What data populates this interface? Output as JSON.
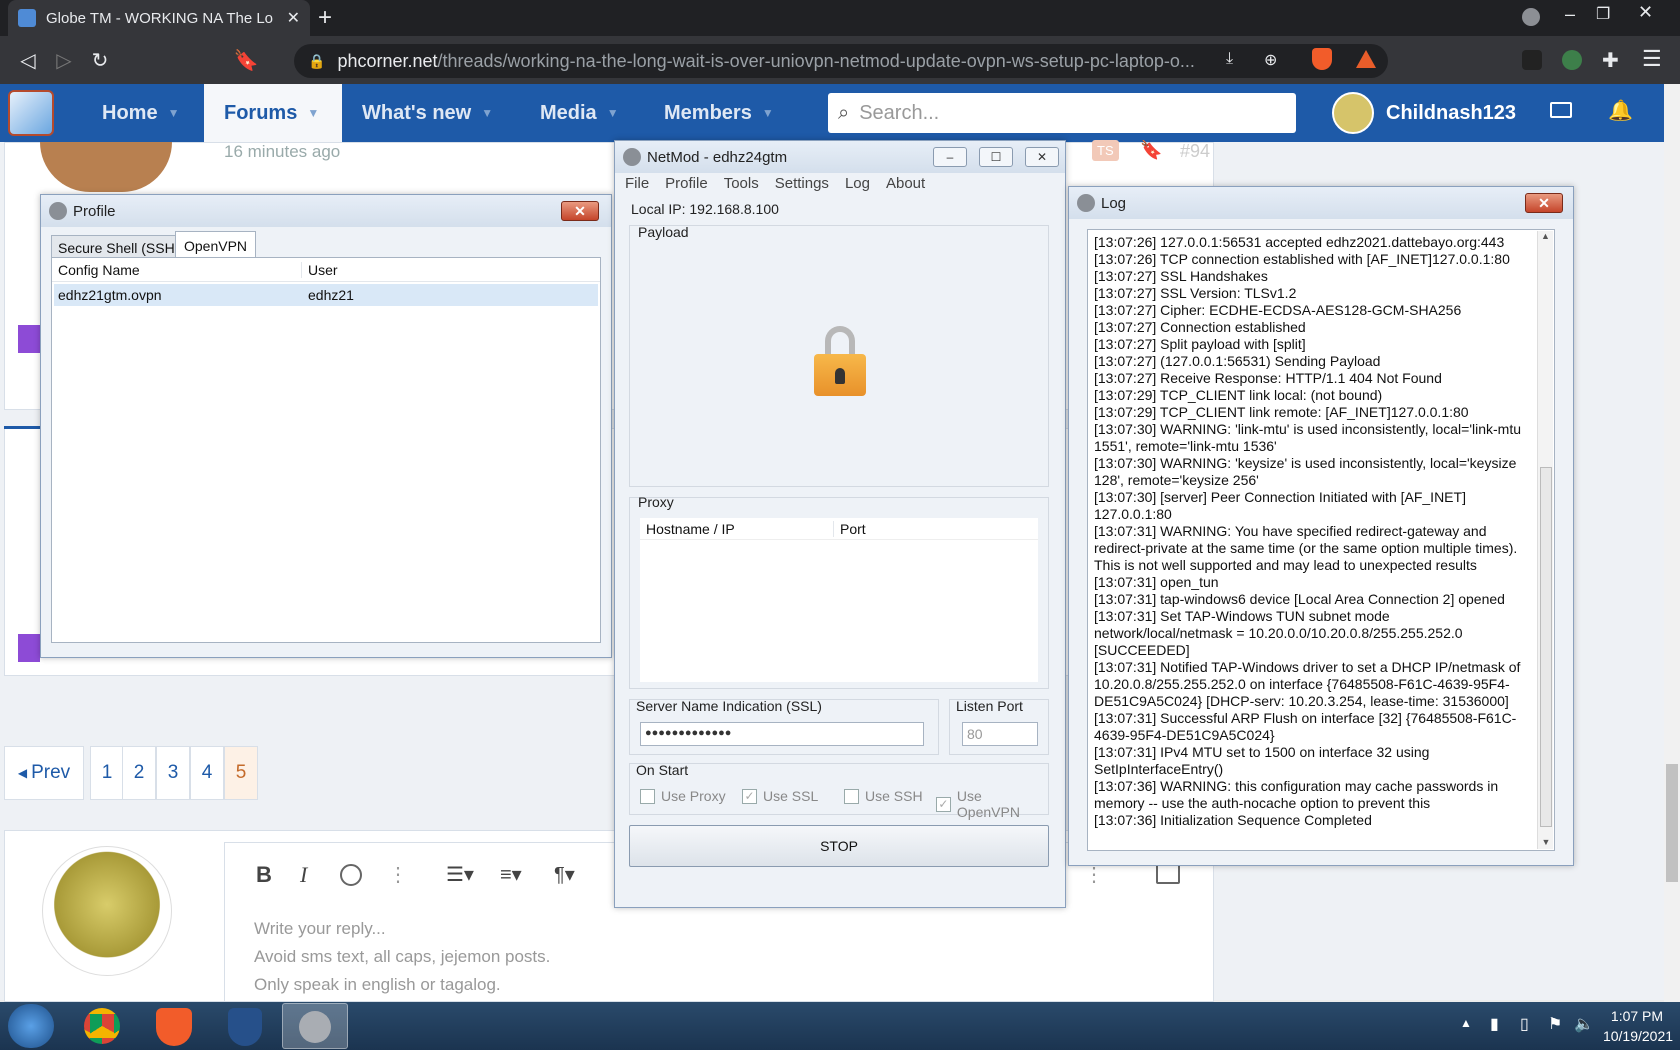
{
  "browser": {
    "tab_title": "Globe TM - WORKING NA The Lo",
    "url_host": "phcorner.net",
    "url_path": "/threads/working-na-the-long-wait-is-over-uniovpn-netmod-update-ovpn-ws-setup-pc-laptop-o..."
  },
  "site": {
    "nav": [
      "Home",
      "Forums",
      "What's new",
      "Media",
      "Members"
    ],
    "search_placeholder": "Search...",
    "username": "Childnash123"
  },
  "forum": {
    "post_time": "16 minutes ago",
    "post_badge": "TS",
    "post_number": "#94",
    "pagination": {
      "prev": "Prev",
      "pages": [
        "1",
        "2",
        "3",
        "4",
        "5"
      ],
      "current": "5"
    },
    "reply": {
      "placeholder_lines": [
        "Write your reply...",
        "Avoid sms text, all caps, jejemon posts.",
        "Only speak in english or tagalog."
      ]
    }
  },
  "profile_window": {
    "title": "Profile",
    "tabs": [
      "Secure Shell (SSH)",
      "OpenVPN"
    ],
    "active_tab": "OpenVPN",
    "columns": [
      "Config Name",
      "User"
    ],
    "rows": [
      {
        "config": "edhz21gtm.ovpn",
        "user": "edhz21"
      }
    ]
  },
  "netmod_window": {
    "title": "NetMod - edhz24gtm",
    "menu": [
      "File",
      "Profile",
      "Tools",
      "Settings",
      "Log",
      "About"
    ],
    "local_ip": "Local IP: 192.168.8.100",
    "payload_label": "Payload",
    "proxy_label": "Proxy",
    "proxy_columns": [
      "Hostname / IP",
      "Port"
    ],
    "sni_label": "Server Name Indication (SSL)",
    "sni_value": "●●●●●●●●●●●●●",
    "listen_port_label": "Listen Port",
    "listen_port_value": "80",
    "on_start_label": "On Start",
    "checkboxes": [
      {
        "label": "Use Proxy",
        "checked": false
      },
      {
        "label": "Use SSL",
        "checked": true
      },
      {
        "label": "Use SSH",
        "checked": false
      },
      {
        "label": "Use OpenVPN",
        "checked": true
      }
    ],
    "stop_label": "STOP"
  },
  "log_window": {
    "title": "Log",
    "lines": [
      "[13:07:26] 127.0.0.1:56531 accepted edhz2021.dattebayo.org:443",
      "[13:07:26] TCP connection established with [AF_INET]127.0.0.1:80",
      "[13:07:27] SSL Handshakes",
      "[13:07:27] SSL Version: TLSv1.2",
      "[13:07:27] Cipher: ECDHE-ECDSA-AES128-GCM-SHA256",
      "[13:07:27] Connection established",
      "[13:07:27] Split payload with [split]",
      "[13:07:27] (127.0.0.1:56531) Sending Payload",
      "[13:07:27] Receive Response: HTTP/1.1 404 Not Found",
      "[13:07:29] TCP_CLIENT link local: (not bound)",
      "[13:07:29] TCP_CLIENT link remote: [AF_INET]127.0.0.1:80",
      "[13:07:30] WARNING: 'link-mtu' is used inconsistently, local='link-mtu",
      "1551', remote='link-mtu 1536'",
      "[13:07:30] WARNING: 'keysize' is used inconsistently, local='keysize",
      "128', remote='keysize 256'",
      "[13:07:30] [server] Peer Connection Initiated with [AF_INET]",
      "127.0.0.1:80",
      "[13:07:31] WARNING: You have specified redirect-gateway and",
      "redirect-private at the same time (or the same option multiple times).",
      "This is not well supported and may lead to unexpected results",
      "[13:07:31] open_tun",
      "[13:07:31] tap-windows6 device [Local Area Connection 2] opened",
      "[13:07:31] Set TAP-Windows TUN subnet mode",
      "network/local/netmask = 10.20.0.0/10.20.0.8/255.255.252.0",
      "[SUCCEEDED]",
      "[13:07:31] Notified TAP-Windows driver to set a DHCP IP/netmask of",
      "10.20.0.8/255.255.252.0 on interface {76485508-F61C-4639-95F4-",
      "DE51C9A5C024} [DHCP-serv: 10.20.3.254, lease-time: 31536000]",
      "[13:07:31] Successful ARP Flush on interface [32] {76485508-F61C-",
      "4639-95F4-DE51C9A5C024}",
      "[13:07:31] IPv4 MTU set to 1500 on interface 32 using",
      "SetIpInterfaceEntry()",
      "[13:07:36] WARNING: this configuration may cache passwords in",
      "memory -- use the auth-nocache option to prevent this",
      "[13:07:36] Initialization Sequence Completed"
    ]
  },
  "taskbar": {
    "time": "1:07 PM",
    "date": "10/19/2021"
  }
}
